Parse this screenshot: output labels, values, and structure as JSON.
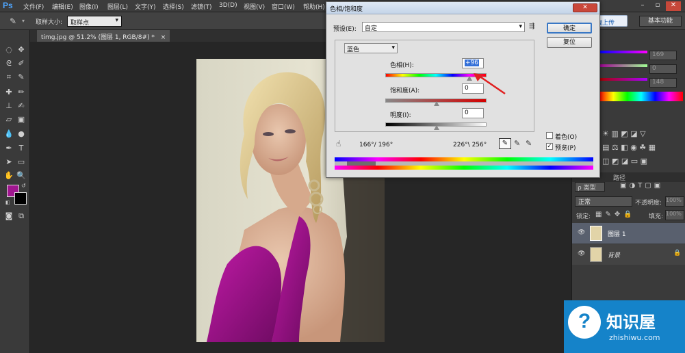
{
  "menubar": {
    "logo": "Ps",
    "items": [
      "文件(F)",
      "编辑(E)",
      "图像(I)",
      "图层(L)",
      "文字(Y)",
      "选择(S)",
      "滤镜(T)",
      "3D(D)",
      "视图(V)",
      "窗口(W)",
      "帮助(H)"
    ]
  },
  "options": {
    "sample_size_label": "取样大小:",
    "sample_size_value": "取样点"
  },
  "document": {
    "tab_title": "timg.jpg @ 51.2% (图层 1, RGB/8#) *",
    "tab_close": "×"
  },
  "workspace": {
    "upload_label": "拖拽上传",
    "workspace_label": "基本功能"
  },
  "dialog": {
    "title": "色相/饱和度",
    "preset_label": "预设(E):",
    "preset_value": "自定",
    "channel_value": "蓝色",
    "hue_label": "色相(H):",
    "hue_value": "+96",
    "saturation_label": "饱和度(A):",
    "saturation_value": "0",
    "lightness_label": "明度(I):",
    "lightness_value": "0",
    "range_left": "166°/ 196°",
    "range_right": "226°\\ 256°",
    "ok_label": "确定",
    "reset_label": "复位",
    "colorize_label": "着色(O)",
    "colorize_checked": false,
    "preview_label": "预览(P)",
    "preview_checked": true
  },
  "color_panel": {
    "r_value": "169",
    "g_value": "0",
    "b_value": "148"
  },
  "layers_panel": {
    "kind_label": "ρ 类型",
    "blend_mode": "正常",
    "opacity_label": "不透明度:",
    "opacity_value": "100%",
    "lock_label": "锁定:",
    "fill_label": "填充:",
    "fill_value": "100%",
    "tab_paths": "路径",
    "layers": [
      {
        "name": "图层 1",
        "selected": true
      },
      {
        "name": "背景",
        "selected": false
      }
    ]
  },
  "watermark": {
    "brand": "知识屋",
    "url": "zhishiwu.com"
  },
  "colors": {
    "foreground": "#a0168f",
    "background": "#000000",
    "accent": "#4fa6ff"
  }
}
